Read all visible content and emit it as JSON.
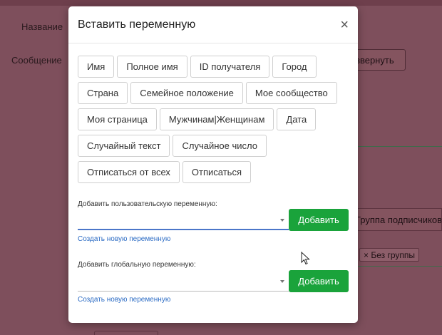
{
  "background": {
    "label_name": "Название",
    "label_message": "Сообщение",
    "expand_button": "звернуть",
    "group_field": "Группа подписчиков",
    "group_tag": "Без группы"
  },
  "modal": {
    "title": "Вставить переменную",
    "close_symbol": "×",
    "variable_rows": [
      [
        "Имя",
        "Полное имя",
        "ID получателя",
        "Город"
      ],
      [
        "Страна",
        "Семейное положение",
        "Мое сообщество"
      ],
      [
        "Моя страница",
        "Мужчинам|Женщинам",
        "Дата"
      ],
      [
        "Случайный текст",
        "Случайное число"
      ],
      [
        "Отписаться от всех",
        "Отписаться"
      ]
    ],
    "custom": {
      "label": "Добавить пользовательскую переменную:",
      "value": "",
      "add_label": "Добавить",
      "create_link": "Создать новую переменную"
    },
    "global": {
      "label": "Добавить глобальную переменную:",
      "value": "",
      "add_label": "Добавить",
      "create_link": "Создать новую переменную"
    }
  },
  "colors": {
    "add_button": "#1aa33b",
    "link": "#2b6bc4",
    "focus_underline": "#4b76c9",
    "overlay": "#7e4f5c"
  }
}
